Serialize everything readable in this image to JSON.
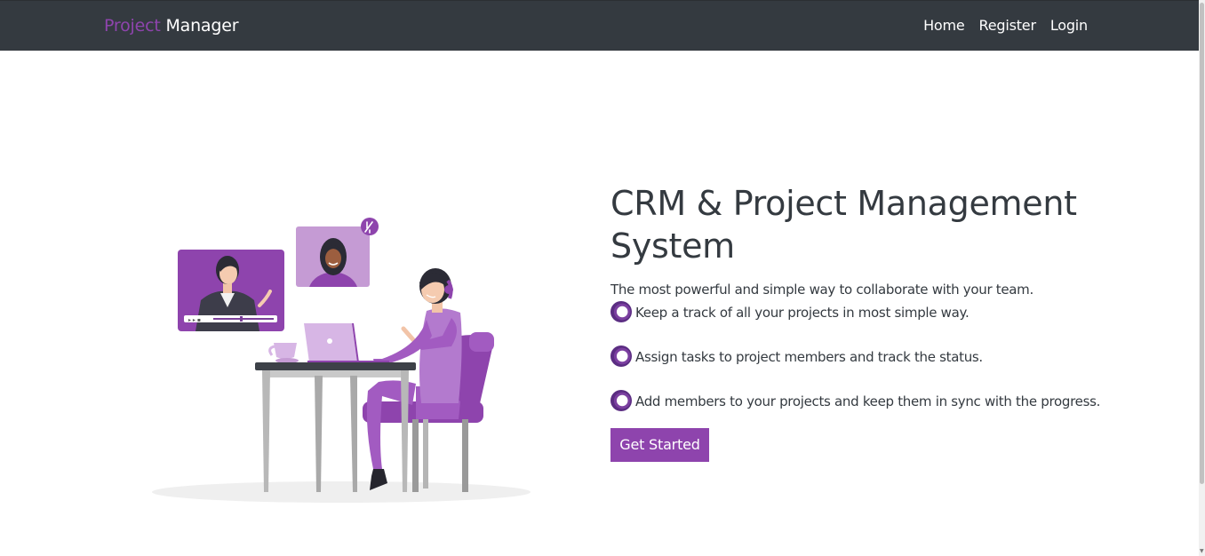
{
  "navbar": {
    "brand_part1": "Project",
    "brand_part2": "Manager",
    "links": [
      "Home",
      "Register",
      "Login"
    ]
  },
  "hero": {
    "title": "CRM & Project Management System",
    "subtitle": "The most powerful and simple way to collaborate with your team.",
    "features": [
      "Keep a track of all your projects in most simple way.",
      "Assign tasks to project members and track the status.",
      "Add members to your projects and keep them in sync with the progress."
    ],
    "cta_label": "Get Started"
  },
  "colors": {
    "navbar_bg": "#343a40",
    "accent": "#8e44ad",
    "text": "#343a40"
  },
  "icons": {
    "feature_bullet": "circle-bullet-icon",
    "mic_muted": "mic-muted-icon"
  }
}
